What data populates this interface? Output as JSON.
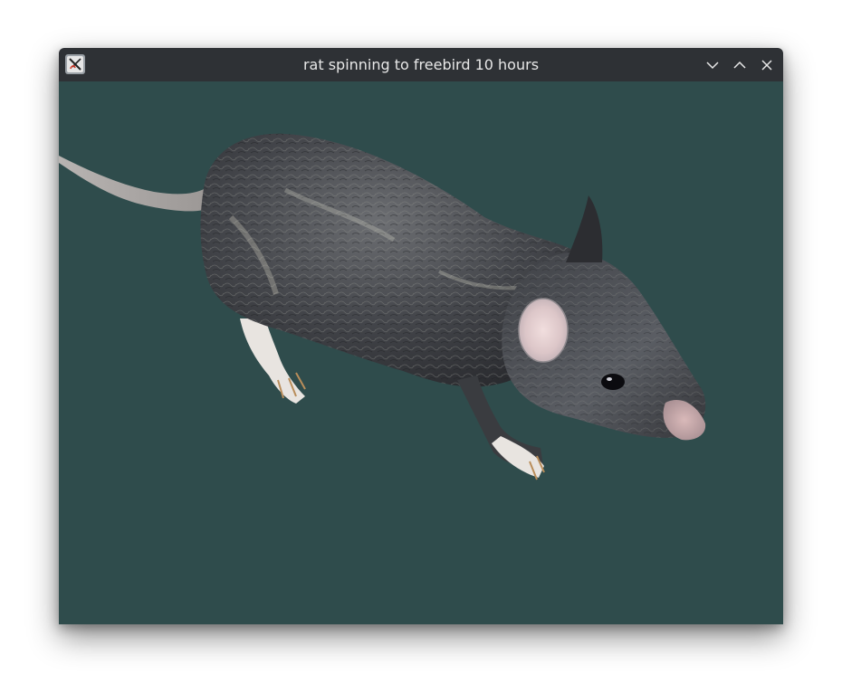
{
  "window": {
    "title": "rat spinning to freebird 10 hours",
    "icon": "x11-icon"
  },
  "titlebar_buttons": {
    "minimize": "chevron-down-icon",
    "maximize": "chevron-up-icon",
    "close": "close-icon"
  },
  "scene": {
    "background_color": "#2f4c4c",
    "subject": "3d-rat-model"
  }
}
